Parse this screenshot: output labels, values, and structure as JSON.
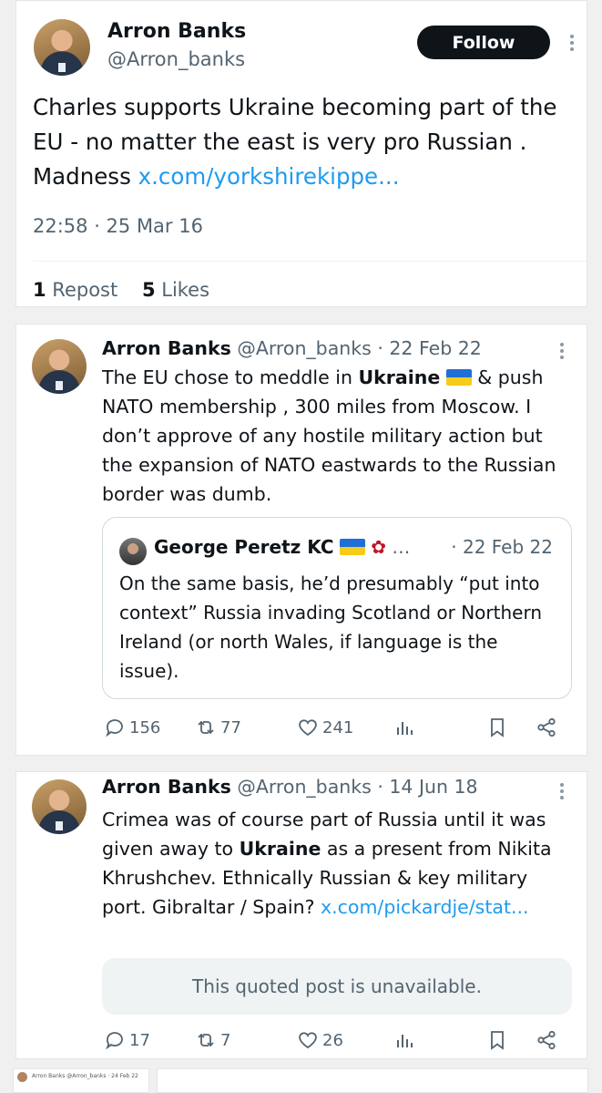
{
  "post": {
    "author_name": "Arron Banks",
    "author_handle": "@Arron_banks",
    "follow_label": "Follow",
    "text": "Charles supports Ukraine becoming part of the EU - no matter the east is very pro Russian . Madness ",
    "link": "x.com/yorkshirekippe...",
    "time": "22:58 · 25 Mar 16",
    "reposts_count": "1",
    "reposts_label": " Repost",
    "likes_count": "5",
    "likes_label": " Likes"
  },
  "tweets": [
    {
      "author_name": "Arron Banks",
      "author_handle": "@Arron_banks · 22 Feb 22",
      "text_before": "The EU chose to meddle in ",
      "highlight": "Ukraine",
      "text_after": " & push NATO membership , 300 miles from Moscow. I don’t approve of any hostile military action but the expansion of NATO eastwards to the Russian border was dumb.",
      "quote": {
        "author_name": "George Peretz KC",
        "author_suffix": "…",
        "date": "· 22 Feb 22",
        "text": "On the same basis, he’d presumably “put into context” Russia invading Scotland or Northern Ireland (or north Wales, if language is the issue)."
      },
      "replies": "156",
      "reposts": "77",
      "likes": "241"
    },
    {
      "author_name": "Arron Banks",
      "author_handle": "@Arron_banks · 14 Jun 18",
      "text_before": "Crimea was of course part of Russia until it was given away to ",
      "highlight": "Ukraine",
      "text_after": " as a present from Nikita Khrushchev. Ethnically Russian & key military port. Gibraltar / Spain? ",
      "link": "x.com/pickardje/stat...",
      "unavailable": "This quoted post is unavailable.",
      "replies": "17",
      "reposts": "7",
      "likes": "26"
    }
  ],
  "sliver": {
    "text": "Arron Banks @Arron_banks · 24 Feb 22"
  },
  "colors": {
    "link": "#1d9bf0",
    "text": "#0f1419",
    "muted": "#536471",
    "button": "#0f1419"
  },
  "icons": [
    "reply-icon",
    "repost-icon",
    "like-icon",
    "views-icon",
    "bookmark-icon",
    "share-icon",
    "more-icon",
    "ukraine-flag-icon",
    "rose-icon"
  ]
}
